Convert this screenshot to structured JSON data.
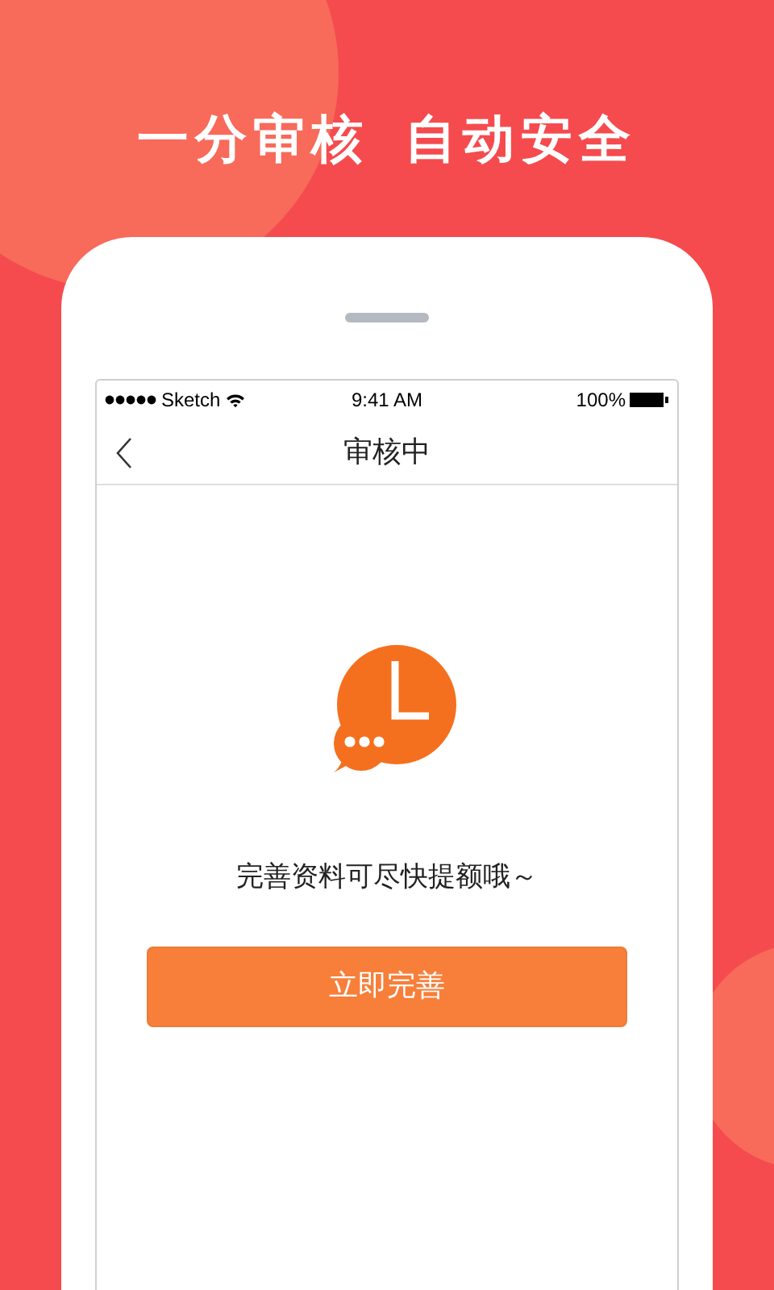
{
  "headline": [
    "一分审核",
    "自动安全"
  ],
  "status_bar": {
    "carrier": "Sketch",
    "time": "9:41 AM",
    "battery": "100%"
  },
  "nav": {
    "title": "审核中"
  },
  "message": "完善资料可尽快提额哦～",
  "button": {
    "label": "立即完善"
  }
}
